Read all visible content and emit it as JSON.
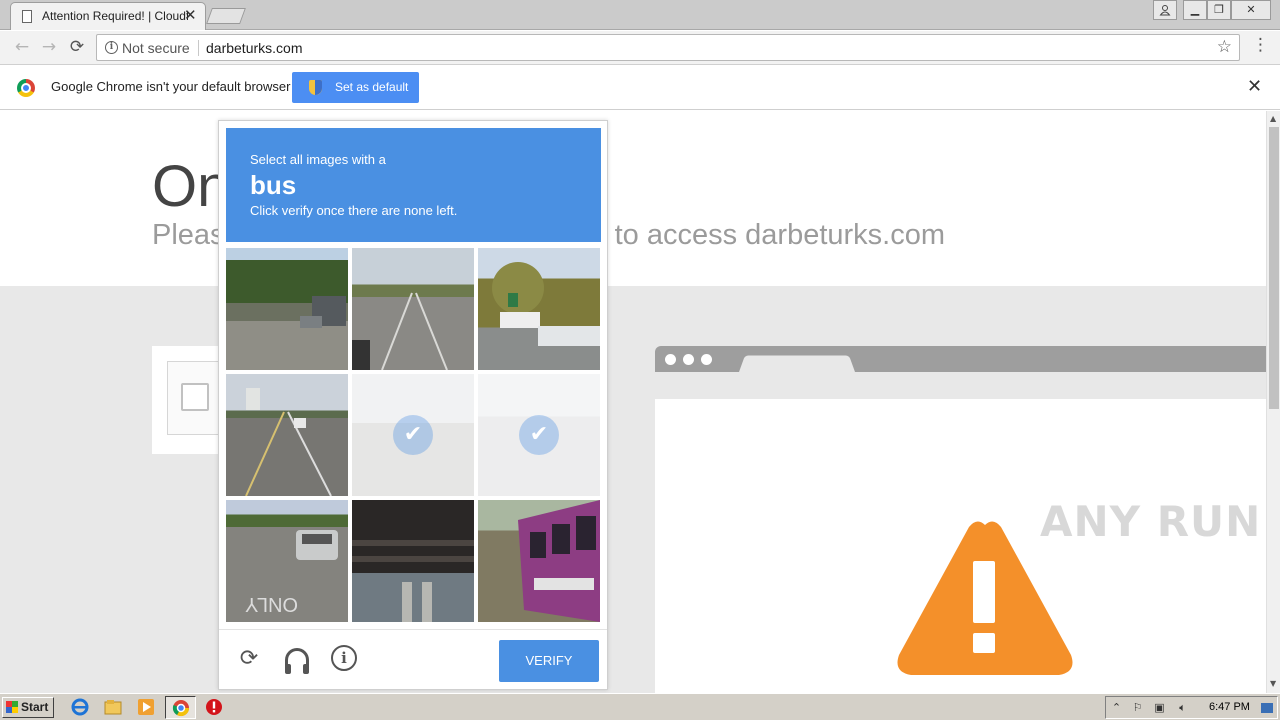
{
  "browser": {
    "tab_title": "Attention Required! | Cloudflare",
    "tab_close": "✕",
    "security_label": "Not secure",
    "url": "darbeturks.com",
    "infobar_text": "Google Chrome isn't your default browser",
    "set_default_label": "Set as default",
    "infobar_close": "✕"
  },
  "page": {
    "title": "One more step",
    "subtitle": "Please complete the security check to access darbeturks.com"
  },
  "captcha": {
    "instruction_line1": "Select all images with a",
    "target": "bus",
    "instruction_line3": "Click verify once there are none left.",
    "verify_label": "VERIFY",
    "tiles_selected": [
      false,
      false,
      false,
      false,
      true,
      true,
      false,
      false,
      false
    ]
  },
  "watermark": "ANY RUN",
  "taskbar": {
    "start_label": "Start",
    "clock": "6:47 PM"
  },
  "colors": {
    "captcha_blue": "#4a90e2",
    "warning_orange": "#f4902a",
    "set_default_blue": "#4c8ef3"
  }
}
